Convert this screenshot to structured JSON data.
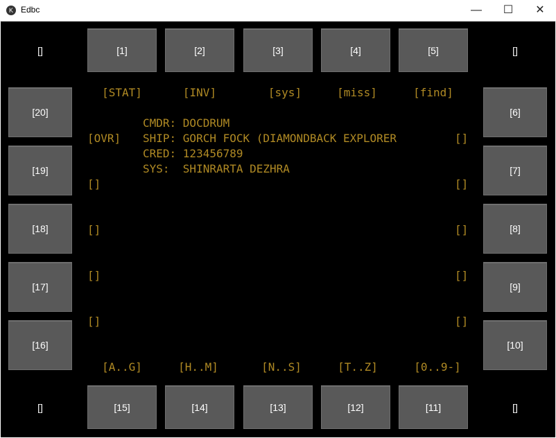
{
  "window": {
    "title": "Edbc",
    "min_icon": "—",
    "max_icon": "☐",
    "close_icon": "✕",
    "app_icon": "K"
  },
  "top_buttons": [
    "[1]",
    "[2]",
    "[3]",
    "[4]",
    "[5]"
  ],
  "right_buttons": [
    "[6]",
    "[7]",
    "[8]",
    "[9]",
    "[10]"
  ],
  "bottom_buttons": [
    "[15]",
    "[14]",
    "[13]",
    "[12]",
    "[11]"
  ],
  "left_buttons": [
    "[20]",
    "[19]",
    "[18]",
    "[17]",
    "[16]"
  ],
  "corners": {
    "top_left": "[]",
    "top_right": "[]",
    "bottom_left": "[]",
    "bottom_right": "[]"
  },
  "top_labels": [
    "[STAT]",
    "[INV]",
    "[sys]",
    "[miss]",
    "[find]"
  ],
  "bottom_labels": [
    "[A..G]",
    "[H..M]",
    "[N..S]",
    "[T..Z]",
    "[0..9-]"
  ],
  "left_labels": [
    "[OVR]",
    "[]",
    "[]",
    "[]",
    "[]"
  ],
  "right_labels": [
    "[]",
    "[]",
    "[]",
    "[]",
    "[]"
  ],
  "info": {
    "cmdr": "CMDR: DOCDRUM",
    "ship": "SHIP: GORCH FOCK (DIAMONDBACK EXPLORER",
    "cred": "CRED: 123456789",
    "sys": "SYS:  SHINRARTA DEZHRA"
  },
  "colors": {
    "background": "#000000",
    "button": "#595959",
    "text": "#b08a24"
  }
}
